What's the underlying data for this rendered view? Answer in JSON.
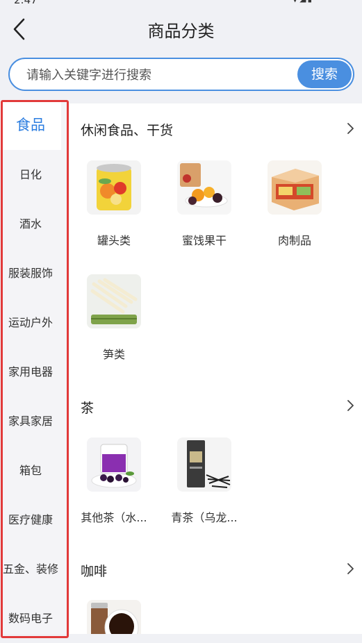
{
  "status": {
    "time": "2:47",
    "icons": "signal-icon wifi-icon battery-icon"
  },
  "header": {
    "title": "商品分类"
  },
  "search": {
    "placeholder": "请输入关键字进行搜索",
    "button": "搜索"
  },
  "sidebar": {
    "items": [
      {
        "label": "食品",
        "active": true
      },
      {
        "label": "日化"
      },
      {
        "label": "酒水"
      },
      {
        "label": "服装服饰"
      },
      {
        "label": "运动户外"
      },
      {
        "label": "家用电器"
      },
      {
        "label": "家具家居"
      },
      {
        "label": "箱包"
      },
      {
        "label": "医疗健康"
      },
      {
        "label": "五金、装修"
      },
      {
        "label": "数码电子"
      }
    ]
  },
  "sections": [
    {
      "title": "休闲食品、干货",
      "items": [
        {
          "label": "罐头类",
          "icon": "canned-food-image"
        },
        {
          "label": "蜜饯果干",
          "icon": "dried-fruit-image"
        },
        {
          "label": "肉制品",
          "icon": "meat-product-image"
        },
        {
          "label": "笋类",
          "icon": "bamboo-shoot-image"
        }
      ]
    },
    {
      "title": "茶",
      "items": [
        {
          "label": "其他茶（水...",
          "icon": "herbal-tea-image"
        },
        {
          "label": "青茶（乌龙...",
          "icon": "oolong-tea-image"
        }
      ]
    },
    {
      "title": "咖啡",
      "items": [
        {
          "label": "",
          "icon": "coffee-image"
        }
      ]
    }
  ],
  "colors": {
    "accent": "#4a8fe0",
    "active_text": "#2b7de0",
    "highlight_border": "#e23a3a"
  }
}
